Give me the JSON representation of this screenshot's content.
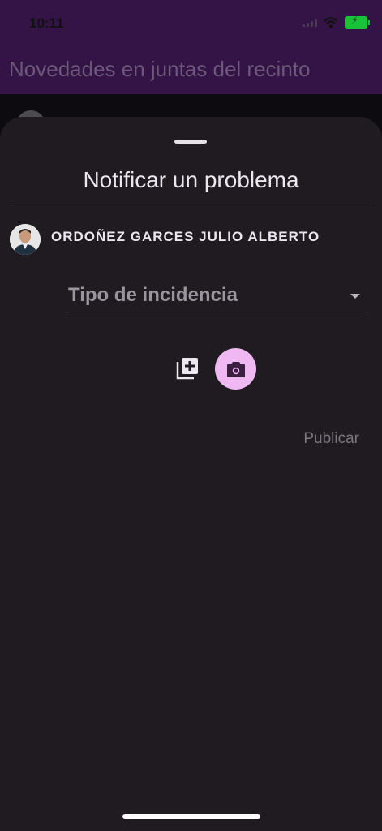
{
  "status_bar": {
    "time": "10:11"
  },
  "header": {
    "title": "Novedades en juntas del recinto"
  },
  "sheet": {
    "title": "Notificar un problema",
    "user_name": "ORDOÑEZ GARCES JULIO ALBERTO",
    "incident_type_placeholder": "Tipo de incidencia",
    "publish_label": "Publicar"
  },
  "colors": {
    "header_bg": "#341446",
    "sheet_bg": "#1f1b21",
    "accent": "#efb8f2"
  },
  "icons": [
    "wifi-icon",
    "battery-icon",
    "add-photo-icon",
    "camera-icon",
    "dropdown-arrow-icon"
  ]
}
